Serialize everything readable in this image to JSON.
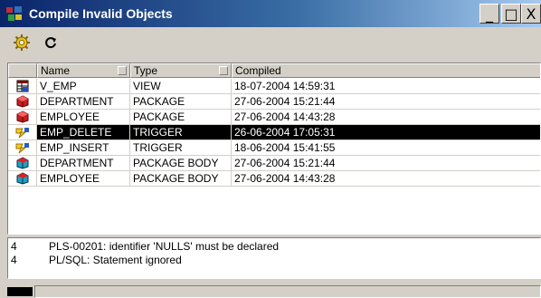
{
  "window": {
    "title": "Compile Invalid Objects",
    "controls": {
      "minimize": "_",
      "maximize": "□",
      "close": "X"
    }
  },
  "toolbar": {
    "buttons": [
      {
        "name": "compile-button",
        "icon": "gear-compile-icon"
      },
      {
        "name": "refresh-button",
        "icon": "refresh-icon"
      }
    ]
  },
  "grid": {
    "columns": [
      "",
      "Name",
      "Type",
      "Compiled"
    ],
    "rows": [
      {
        "icon": "view-icon",
        "name": "V_EMP",
        "type": "VIEW",
        "compiled": "18-07-2004 14:59:31",
        "selected": false
      },
      {
        "icon": "package-icon",
        "name": "DEPARTMENT",
        "type": "PACKAGE",
        "compiled": "27-06-2004 15:21:44",
        "selected": false
      },
      {
        "icon": "package-icon",
        "name": "EMPLOYEE",
        "type": "PACKAGE",
        "compiled": "27-06-2004 14:43:28",
        "selected": false
      },
      {
        "icon": "trigger-icon",
        "name": "EMP_DELETE",
        "type": "TRIGGER",
        "compiled": "26-06-2004 17:05:31",
        "selected": true
      },
      {
        "icon": "trigger-icon",
        "name": "EMP_INSERT",
        "type": "TRIGGER",
        "compiled": "18-06-2004 15:41:55",
        "selected": false
      },
      {
        "icon": "package-body-icon",
        "name": "DEPARTMENT",
        "type": "PACKAGE BODY",
        "compiled": "27-06-2004 15:21:44",
        "selected": false
      },
      {
        "icon": "package-body-icon",
        "name": "EMPLOYEE",
        "type": "PACKAGE BODY",
        "compiled": "27-06-2004 14:43:28",
        "selected": false
      }
    ]
  },
  "messages": [
    {
      "line": "4",
      "text": "PLS-00201: identifier 'NULLS' must be declared"
    },
    {
      "line": "4",
      "text": "PL/SQL: Statement ignored"
    }
  ],
  "colors": {
    "title_start": "#0a246a",
    "title_end": "#a6caf0",
    "selection": "#000000",
    "chrome": "#d4d0c8"
  }
}
